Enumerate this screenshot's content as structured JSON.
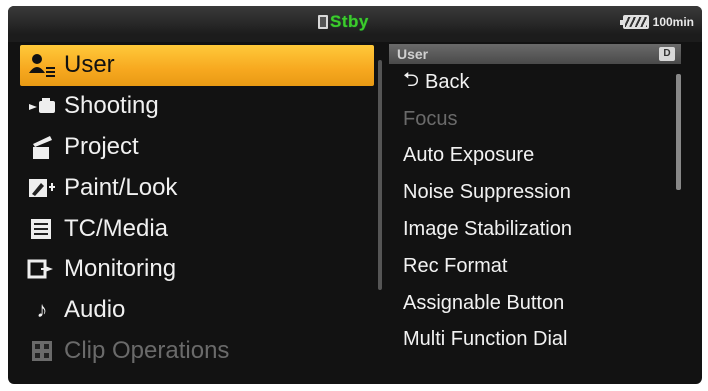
{
  "status_bar": {
    "mode": "Stby",
    "battery": "100min"
  },
  "main_menu": {
    "items": [
      {
        "label": "User",
        "icon": "user-icon",
        "selected": true,
        "disabled": false
      },
      {
        "label": "Shooting",
        "icon": "camera-icon",
        "selected": false,
        "disabled": false
      },
      {
        "label": "Project",
        "icon": "clapperboard-icon",
        "selected": false,
        "disabled": false
      },
      {
        "label": "Paint/Look",
        "icon": "paint-icon",
        "selected": false,
        "disabled": false
      },
      {
        "label": "TC/Media",
        "icon": "media-icon",
        "selected": false,
        "disabled": false
      },
      {
        "label": "Monitoring",
        "icon": "monitor-output-icon",
        "selected": false,
        "disabled": false
      },
      {
        "label": "Audio",
        "icon": "music-note-icon",
        "selected": false,
        "disabled": false
      },
      {
        "label": "Clip Operations",
        "icon": "clip-grid-icon",
        "selected": false,
        "disabled": true
      }
    ]
  },
  "sub_menu": {
    "header": "User",
    "page_badge": "D",
    "items": [
      {
        "label": "Back",
        "disabled": false
      },
      {
        "label": "Focus",
        "disabled": true
      },
      {
        "label": "Auto Exposure",
        "disabled": false
      },
      {
        "label": "Noise Suppression",
        "disabled": false
      },
      {
        "label": "Image Stabilization",
        "disabled": false
      },
      {
        "label": "Rec Format",
        "disabled": false
      },
      {
        "label": "Assignable Button",
        "disabled": false
      },
      {
        "label": "Multi Function Dial",
        "disabled": false
      }
    ]
  }
}
